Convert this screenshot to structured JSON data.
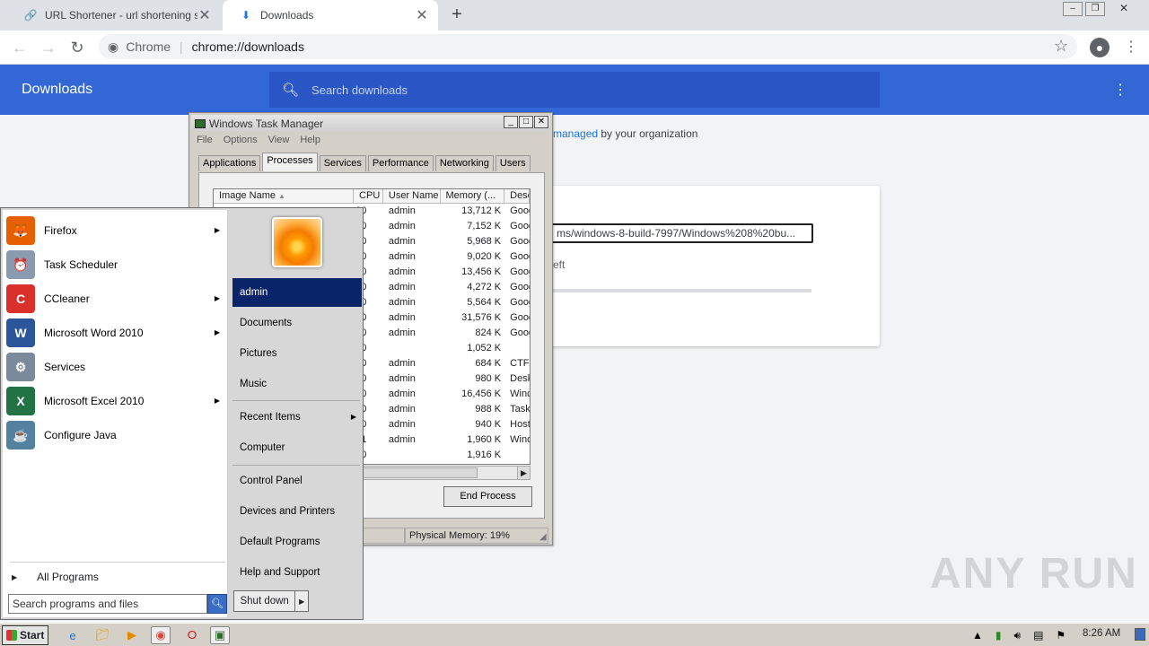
{
  "browser": {
    "tabs": [
      {
        "label": "URL Shortener - url shortening servic",
        "icon": "link-icon"
      },
      {
        "label": "Downloads",
        "icon": "download-icon",
        "active": true
      }
    ],
    "chip": "Chrome",
    "url": "chrome://downloads"
  },
  "downloads": {
    "title": "Downloads",
    "search_placeholder": "Search downloads",
    "managed_prefix": "",
    "managed_link": "managed",
    "managed_suffix": " by your organization",
    "item_url": "ms/windows-8-build-7997/Windows%208%20bu...",
    "item_status": "eft"
  },
  "taskmanager": {
    "title": "Windows Task Manager",
    "menu": [
      "File",
      "Options",
      "View",
      "Help"
    ],
    "tabs": [
      "Applications",
      "Processes",
      "Services",
      "Performance",
      "Networking",
      "Users"
    ],
    "active_tab": "Processes",
    "columns": [
      "Image Name",
      "CPU",
      "User Name",
      "Memory (...",
      "Desc"
    ],
    "rows": [
      {
        "cpu": "00",
        "user": "admin",
        "mem": "13,712 K",
        "desc": "Goog"
      },
      {
        "cpu": "00",
        "user": "admin",
        "mem": "7,152 K",
        "desc": "Goog"
      },
      {
        "cpu": "00",
        "user": "admin",
        "mem": "5,968 K",
        "desc": "Goog"
      },
      {
        "cpu": "00",
        "user": "admin",
        "mem": "9,020 K",
        "desc": "Goog"
      },
      {
        "cpu": "00",
        "user": "admin",
        "mem": "13,456 K",
        "desc": "Goog"
      },
      {
        "cpu": "00",
        "user": "admin",
        "mem": "4,272 K",
        "desc": "Goog"
      },
      {
        "cpu": "00",
        "user": "admin",
        "mem": "5,564 K",
        "desc": "Goog"
      },
      {
        "cpu": "00",
        "user": "admin",
        "mem": "31,576 K",
        "desc": "Goog"
      },
      {
        "cpu": "00",
        "user": "admin",
        "mem": "824 K",
        "desc": "Goog"
      },
      {
        "cpu": "00",
        "user": "",
        "mem": "1,052 K",
        "desc": ""
      },
      {
        "cpu": "00",
        "user": "admin",
        "mem": "684 K",
        "desc": "CTF l"
      },
      {
        "cpu": "00",
        "user": "admin",
        "mem": "980 K",
        "desc": "Desk"
      },
      {
        "cpu": "00",
        "user": "admin",
        "mem": "16,456 K",
        "desc": "Wind"
      },
      {
        "cpu": "00",
        "user": "admin",
        "mem": "988 K",
        "desc": "Task"
      },
      {
        "cpu": "00",
        "user": "admin",
        "mem": "940 K",
        "desc": "Host"
      },
      {
        "cpu": "01",
        "user": "admin",
        "mem": "1,960 K",
        "desc": "Wind"
      },
      {
        "cpu": "00",
        "user": "",
        "mem": "1,916 K",
        "desc": ""
      }
    ],
    "end_process": "End Process",
    "status_memory": "Physical Memory: 19%"
  },
  "startmenu": {
    "programs": [
      {
        "label": "Firefox",
        "icon": "firefox-icon",
        "color": "#e66000",
        "glyph": "🦊",
        "submenu": true
      },
      {
        "label": "Task Scheduler",
        "icon": "clock-icon",
        "color": "#8a9bb0",
        "glyph": "⏰",
        "submenu": false
      },
      {
        "label": "CCleaner",
        "icon": "ccleaner-icon",
        "color": "#d9302c",
        "glyph": "C",
        "submenu": true
      },
      {
        "label": "Microsoft Word 2010",
        "icon": "word-icon",
        "color": "#2b579a",
        "glyph": "W",
        "submenu": true
      },
      {
        "label": "Services",
        "icon": "gears-icon",
        "color": "#7a8a9a",
        "glyph": "⚙",
        "submenu": false
      },
      {
        "label": "Microsoft Excel 2010",
        "icon": "excel-icon",
        "color": "#217346",
        "glyph": "X",
        "submenu": true
      },
      {
        "label": "Configure Java",
        "icon": "java-icon",
        "color": "#5382a1",
        "glyph": "☕",
        "submenu": false
      }
    ],
    "all_programs": "All Programs",
    "search_placeholder": "Search programs and files",
    "right_items": [
      "admin",
      "Documents",
      "Pictures",
      "Music",
      "Recent Items",
      "Computer",
      "Control Panel",
      "Devices and Printers",
      "Default Programs",
      "Help and Support"
    ],
    "shutdown": "Shut down"
  },
  "taskbar": {
    "start": "Start",
    "clock": "8:26 AM"
  },
  "watermark": "ANY RUN"
}
